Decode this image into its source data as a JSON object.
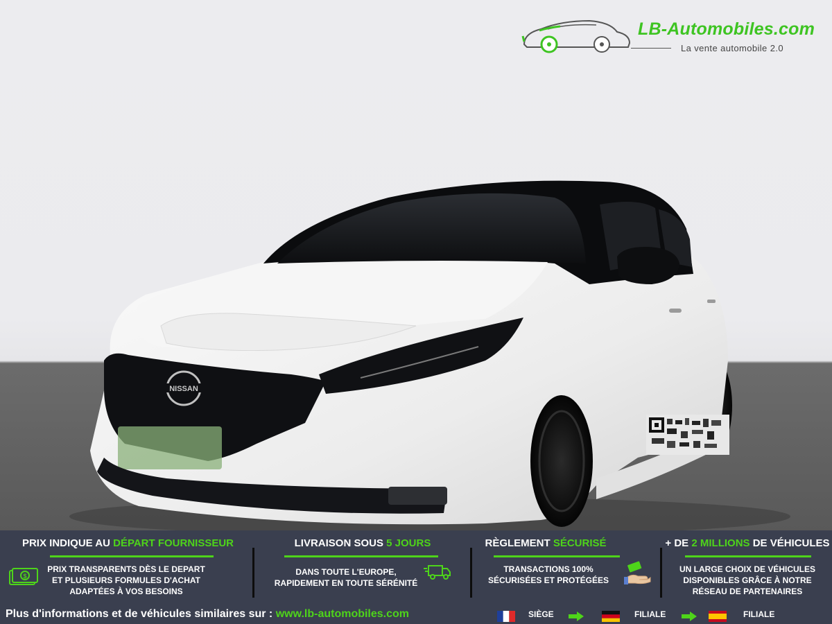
{
  "brand": {
    "name": "LB-Automobiles.com",
    "tagline": "La vente automobile 2.0",
    "accent_color": "#4ed41a",
    "band_color": "#3a3f4f"
  },
  "photo": {
    "grille_badge_text": "NISSAN"
  },
  "features": [
    {
      "title_prefix": "PRIX INDIQUE AU ",
      "title_highlight": "DÉPART FOURNISSEUR",
      "title_suffix": "",
      "desc_lines": [
        "PRIX TRANSPARENTS DÈS LE DEPART",
        "ET PLUSIEURS FORMULES D'ACHAT",
        "ADAPTÉES À VOS BESOINS"
      ],
      "icon": "money-icon"
    },
    {
      "title_prefix": "LIVRAISON SOUS ",
      "title_highlight": "5 JOURS",
      "title_suffix": "",
      "desc_lines": [
        "DANS TOUTE L'EUROPE,",
        "RAPIDEMENT EN TOUTE SÉRÉNITÉ"
      ],
      "icon": "delivery-truck-icon"
    },
    {
      "title_prefix": "RÈGLEMENT ",
      "title_highlight": "SÉCURISÉ",
      "title_suffix": "",
      "desc_lines": [
        "TRANSACTIONS 100%",
        "SÉCURISÉES ET PROTÉGÉES"
      ],
      "icon": "payment-hand-icon"
    },
    {
      "title_prefix": "+ DE ",
      "title_highlight": "2 MILLIONS",
      "title_suffix": " DE VÉHICULES",
      "desc_lines": [
        "UN LARGE CHOIX DE VÉHICULES",
        "DISPONIBLES GRÂCE À NOTRE",
        "RÉSEAU DE PARTENAIRES"
      ],
      "icon": ""
    }
  ],
  "footer": {
    "more_info_prefix": "Plus d'informations et de véhicules similaires sur : ",
    "more_info_url": "www.lb-automobiles.com",
    "locations": [
      {
        "country": "france",
        "label": "SIÈGE"
      },
      {
        "country": "germany",
        "label": "FILIALE"
      },
      {
        "country": "spain",
        "label": "FILIALE"
      }
    ]
  }
}
